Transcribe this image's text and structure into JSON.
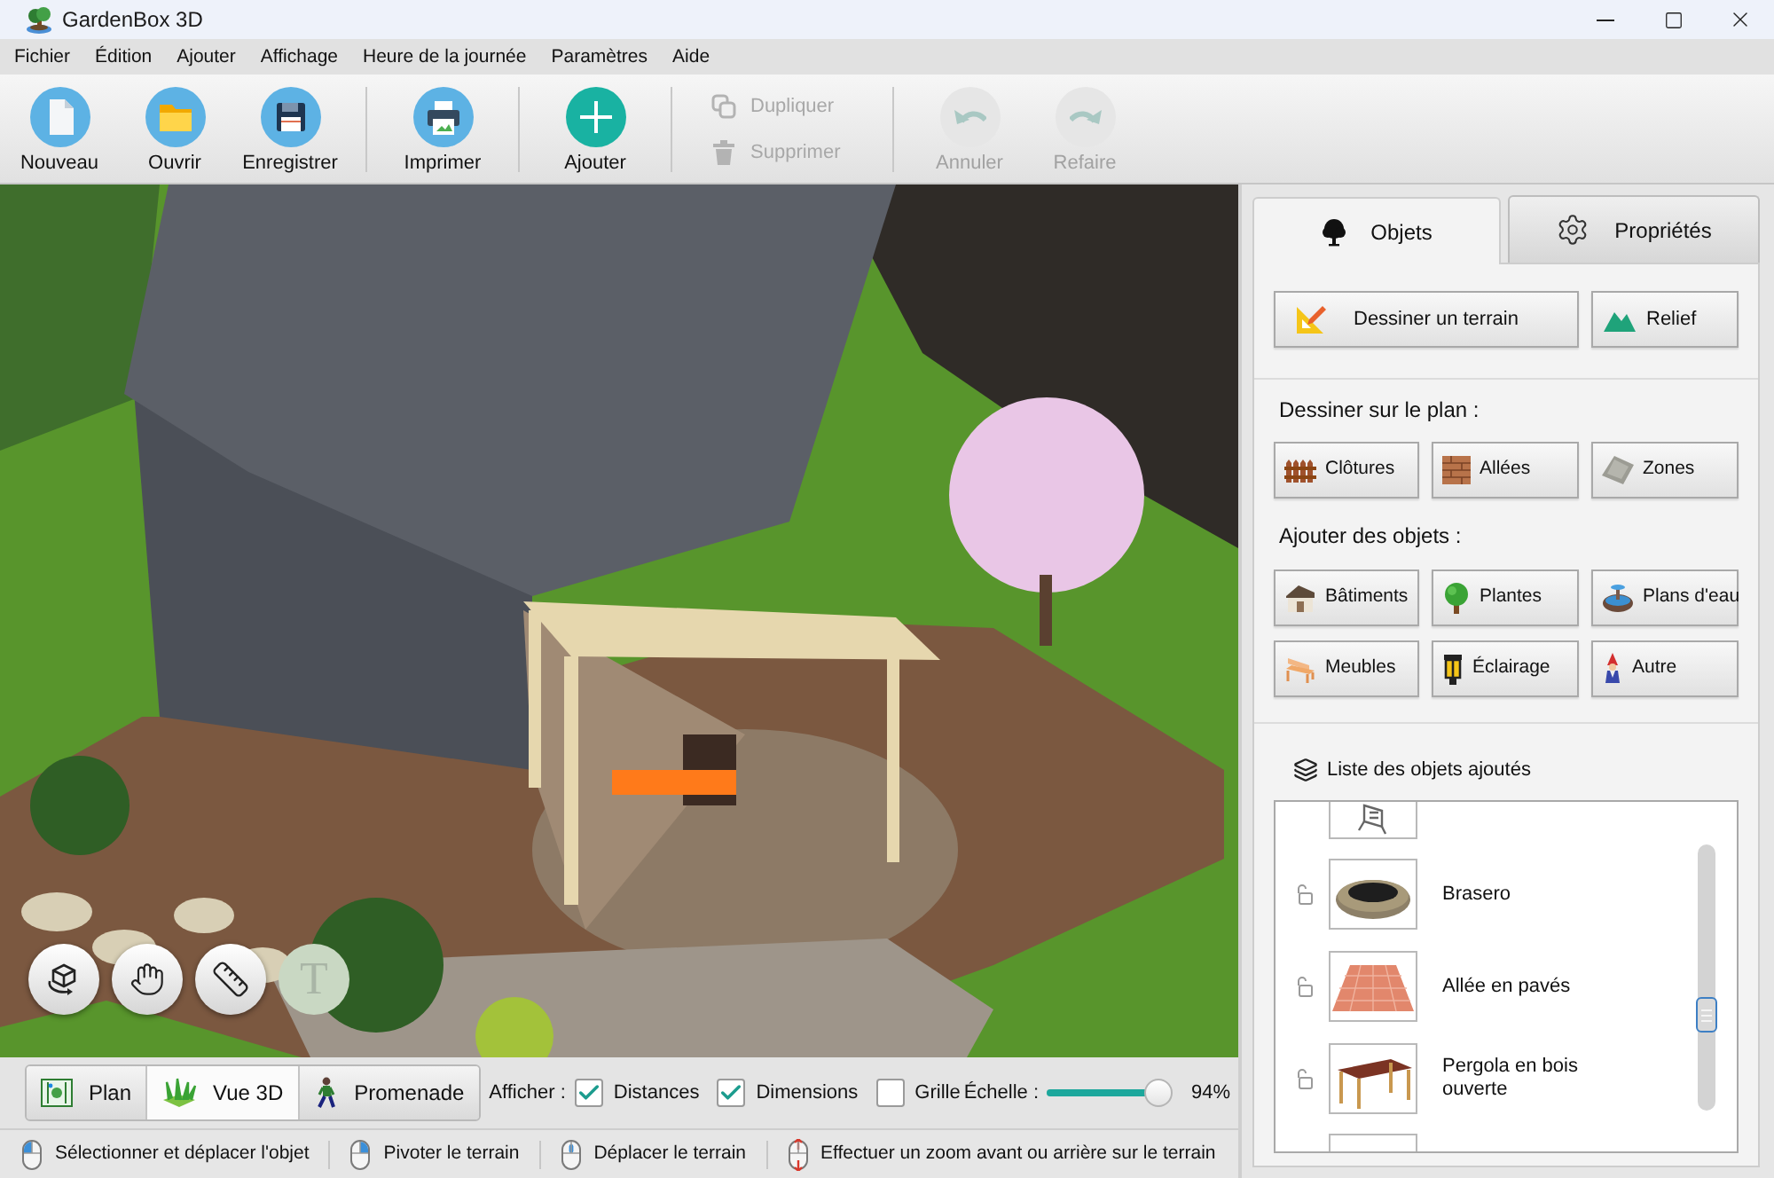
{
  "window": {
    "title": "GardenBox 3D"
  },
  "menu": [
    "Fichier",
    "Édition",
    "Ajouter",
    "Affichage",
    "Heure de la journée",
    "Paramètres",
    "Aide"
  ],
  "toolbar": [
    {
      "kind": "large",
      "buttons": [
        {
          "kind": "new",
          "label": "Nouveau",
          "disabled": false
        },
        {
          "kind": "open",
          "label": "Ouvrir",
          "disabled": false
        },
        {
          "kind": "save",
          "label": "Enregistrer",
          "disabled": false
        }
      ]
    },
    {
      "kind": "large",
      "buttons": [
        {
          "kind": "print",
          "label": "Imprimer",
          "disabled": false
        }
      ]
    },
    {
      "kind": "large",
      "buttons": [
        {
          "kind": "add",
          "label": "Ajouter",
          "disabled": false
        }
      ]
    },
    {
      "kind": "stack",
      "buttons": [
        {
          "kind": "duplicate",
          "label": "Dupliquer",
          "disabled": true
        },
        {
          "kind": "delete",
          "label": "Supprimer",
          "disabled": true
        }
      ]
    },
    {
      "kind": "large",
      "buttons": [
        {
          "kind": "undo",
          "label": "Annuler",
          "disabled": true
        },
        {
          "kind": "redo",
          "label": "Refaire",
          "disabled": true
        }
      ]
    }
  ],
  "scene": {
    "tools": [
      {
        "kind": "rotate",
        "disabled": false
      },
      {
        "kind": "pan",
        "disabled": false
      },
      {
        "kind": "measure",
        "disabled": false
      },
      {
        "kind": "text",
        "label": "T",
        "disabled": true
      }
    ]
  },
  "view_bar": {
    "views": [
      {
        "kind": "plan",
        "label": "Plan",
        "selected": false
      },
      {
        "kind": "perspective",
        "label": "Vue 3D",
        "selected": true
      },
      {
        "kind": "walk",
        "label": "Promenade",
        "selected": false
      }
    ],
    "show_label": "Afficher :",
    "options": [
      {
        "label": "Distances",
        "checked": true
      },
      {
        "label": "Dimensions",
        "checked": true
      },
      {
        "label": "Grille",
        "checked": false
      }
    ],
    "scale": {
      "label": "Échelle :",
      "level": 0.94,
      "reading": "94%"
    }
  },
  "status_bar": [
    {
      "kind": "left",
      "text": "Sélectionner et déplacer l'objet"
    },
    {
      "kind": "right",
      "text": "Pivoter le terrain"
    },
    {
      "kind": "middle",
      "text": "Déplacer le terrain"
    },
    {
      "kind": "wheel",
      "text": "Effectuer un zoom avant ou arrière sur le terrain"
    }
  ],
  "panel": {
    "tabs": [
      {
        "kind": "tree",
        "label": "Objets",
        "selected": true
      },
      {
        "kind": "gear",
        "label": "Propriétés",
        "selected": false
      }
    ],
    "terrain_buttons": [
      {
        "kind": "terrain",
        "label": "Dessiner un terrain"
      },
      {
        "kind": "relief",
        "label": "Relief"
      }
    ],
    "sections": [
      {
        "heading": "Dessiner sur le plan :",
        "buttons": [
          {
            "kind": "fence",
            "label": "Clôtures"
          },
          {
            "kind": "path",
            "label": "Allées"
          },
          {
            "kind": "zone",
            "label": "Zones"
          }
        ]
      },
      {
        "heading": "Ajouter des objets :",
        "buttons": [
          {
            "kind": "building",
            "label": "Bâtiments"
          },
          {
            "kind": "plant",
            "label": "Plantes"
          },
          {
            "kind": "water",
            "label": "Plans d'eau"
          },
          {
            "kind": "furniture",
            "label": "Meubles"
          },
          {
            "kind": "lighting",
            "label": "Éclairage"
          },
          {
            "kind": "other",
            "label": "Autre"
          }
        ]
      }
    ],
    "objects": {
      "heading": "Liste des objets ajoutés",
      "items": [
        {
          "kind": "clipped"
        },
        {
          "kind": "firepit",
          "name": "Brasero",
          "locked": false
        },
        {
          "kind": "paving",
          "name": "Allée en pavés",
          "locked": false
        },
        {
          "kind": "pergola",
          "name": "Pergola en bois ouverte",
          "locked": false
        },
        {
          "kind": "clipped"
        }
      ]
    }
  }
}
